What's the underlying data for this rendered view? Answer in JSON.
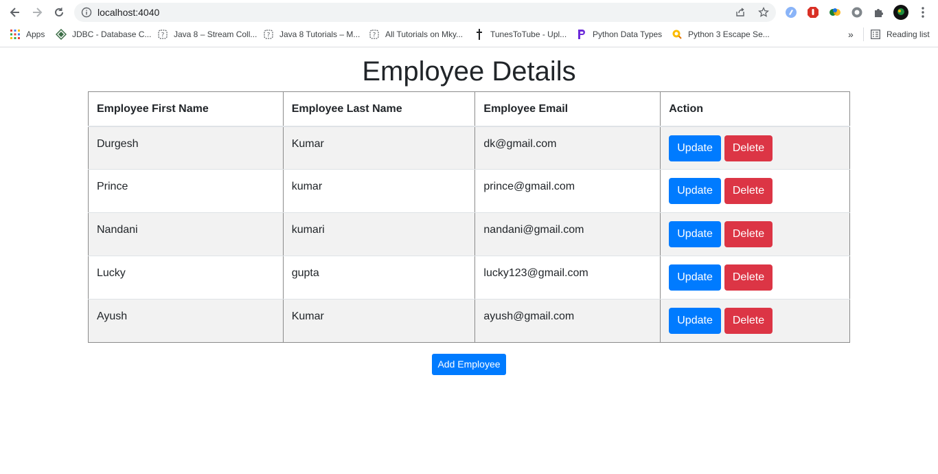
{
  "browser": {
    "url": "localhost:4040",
    "bookmarks": [
      {
        "label": "Apps",
        "icon": "apps-grid-icon"
      },
      {
        "label": "JDBC - Database C...",
        "icon": "diamond-icon"
      },
      {
        "label": "Java 8 – Stream Coll...",
        "icon": "help-circle-icon"
      },
      {
        "label": "Java 8 Tutorials – M...",
        "icon": "help-circle-icon"
      },
      {
        "label": "All Tutorials on Mky...",
        "icon": "help-circle-icon"
      },
      {
        "label": "TunesToTube - Upl...",
        "icon": "dagger-icon"
      },
      {
        "label": "Python Data Types",
        "icon": "p-logo-icon"
      },
      {
        "label": "Python 3 Escape Se...",
        "icon": "search-badge-icon"
      }
    ],
    "more_bookmarks": "»",
    "reading_list": "Reading list"
  },
  "page": {
    "title": "Employee Details",
    "columns": [
      "Employee First Name",
      "Employee Last Name",
      "Employee Email",
      "Action"
    ],
    "rows": [
      {
        "first": "Durgesh",
        "last": "Kumar",
        "email": "dk@gmail.com"
      },
      {
        "first": "Prince",
        "last": "kumar",
        "email": "prince@gmail.com"
      },
      {
        "first": "Nandani",
        "last": "kumari",
        "email": "nandani@gmail.com"
      },
      {
        "first": "Lucky",
        "last": "gupta",
        "email": "lucky123@gmail.com"
      },
      {
        "first": "Ayush",
        "last": "Kumar",
        "email": "ayush@gmail.com"
      }
    ],
    "update_label": "Update",
    "delete_label": "Delete",
    "add_label": "Add Employee"
  },
  "colors": {
    "primary": "#007bff",
    "danger": "#dc3545",
    "stripe": "#f2f2f2"
  }
}
